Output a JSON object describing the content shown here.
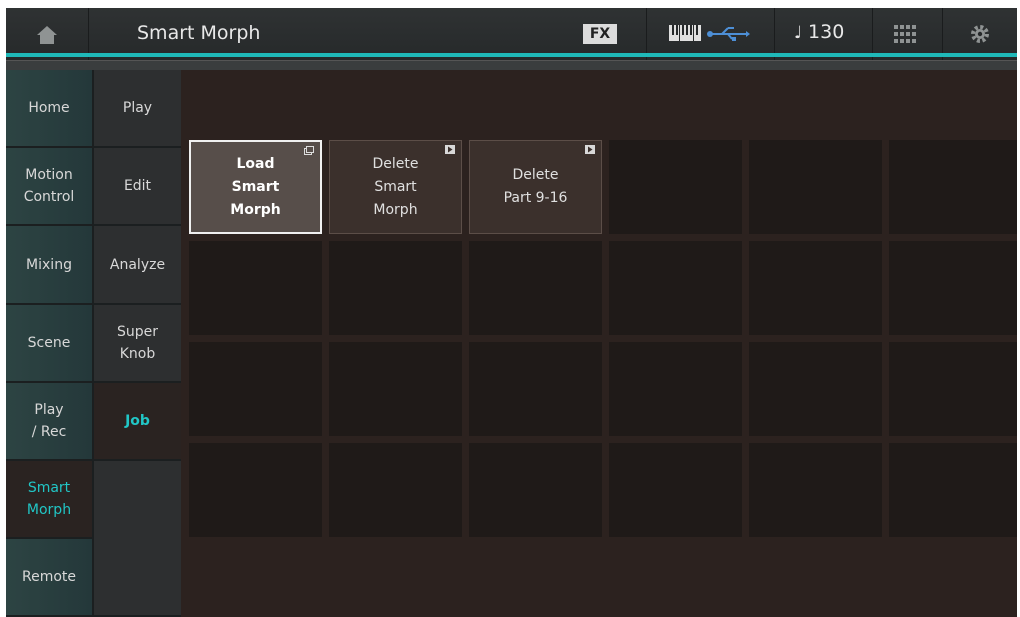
{
  "header": {
    "title": "Smart Morph",
    "fx_label": "FX",
    "tempo": "130",
    "tempo_note": "♩"
  },
  "nav_primary": [
    {
      "label": "Home",
      "active": false
    },
    {
      "label": "Motion\nControl",
      "active": false
    },
    {
      "label": "Mixing",
      "active": false
    },
    {
      "label": "Scene",
      "active": false
    },
    {
      "label": "Play\n/ Rec",
      "active": false
    },
    {
      "label": "Smart\nMorph",
      "active": true
    },
    {
      "label": "Remote",
      "active": false
    }
  ],
  "nav_secondary": [
    {
      "label": "Play",
      "active": false
    },
    {
      "label": "Edit",
      "active": false
    },
    {
      "label": "Analyze",
      "active": false
    },
    {
      "label": "Super\nKnob",
      "active": false
    },
    {
      "label": "Job",
      "active": true
    },
    {
      "label": "",
      "active": false
    }
  ],
  "jobs": [
    {
      "label": "Load\nSmart\nMorph",
      "selected": true,
      "icon": "popup-icon"
    },
    {
      "label": "Delete\nSmart\nMorph",
      "selected": false,
      "icon": "play-icon"
    },
    {
      "label": "Delete\nPart 9-16",
      "selected": false,
      "icon": "play-icon"
    }
  ],
  "colors": {
    "accent": "#1fb9b9",
    "active_text": "#21c6c6"
  }
}
